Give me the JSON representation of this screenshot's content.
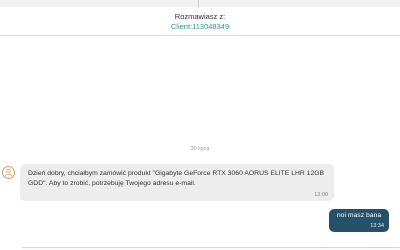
{
  "header": {
    "label": "Rozmawiasz z:",
    "client": "Client:113048349"
  },
  "chat": {
    "date_separator": "30 lipca",
    "messages": [
      {
        "direction": "incoming",
        "text": "Dzień dobry, chciałbym zamówić produkt \"Gigabyte GeForce RTX 3060 AORUS ELITE LHR 12GB GDD\". Aby to zrobić, potrzebuję Twojego adresu e-mail.",
        "time": "13:00",
        "avatar_icon": "user-icon"
      },
      {
        "direction": "outgoing",
        "text": "noi masz bana",
        "time": "13:34"
      }
    ]
  },
  "colors": {
    "client_link": "#2e9a8c",
    "outgoing_bubble": "#27516b",
    "incoming_bubble": "#ededed",
    "avatar_accent": "#e39a6d"
  }
}
